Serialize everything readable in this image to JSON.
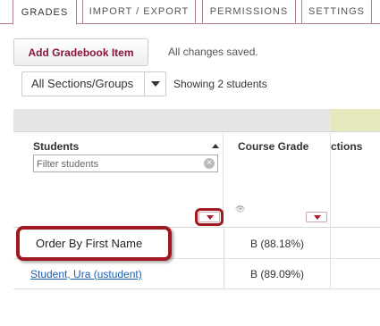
{
  "tabs": [
    {
      "label": "GRADES",
      "active": true
    },
    {
      "label": "IMPORT / EXPORT",
      "active": false
    },
    {
      "label": "PERMISSIONS",
      "active": false
    },
    {
      "label": "SETTINGS",
      "active": false
    }
  ],
  "toolbar": {
    "add_item_label": "Add Gradebook Item",
    "save_status": "All changes saved."
  },
  "filter_bar": {
    "section_selected": "All Sections/Groups",
    "showing_text": "Showing 2 students"
  },
  "grid": {
    "students_header": "Students",
    "filter_placeholder": "Filter students",
    "course_grade_header": "Course Grade",
    "sections_header_partial": "ctions",
    "rows": [
      {
        "menu_item": "Order By First Name",
        "course_grade": "B (88.18%)"
      },
      {
        "student": "Student, Ura (ustudent)",
        "course_grade": "B (89.09%)"
      }
    ]
  },
  "colors": {
    "brand": "#8a1538",
    "highlight": "#a01820",
    "link": "#1a5fb4",
    "accent_band": "#e6e9be"
  },
  "icons": {
    "sort": "sort-ascending-icon",
    "clear": "clear-icon",
    "dropdown": "caret-down-icon",
    "hidden": "eye-hidden-icon"
  }
}
